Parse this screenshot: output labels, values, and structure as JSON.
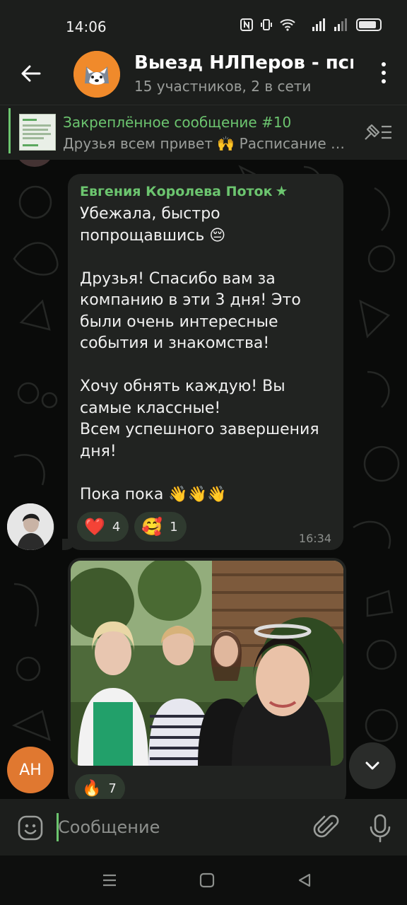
{
  "status_bar": {
    "time": "14:06"
  },
  "header": {
    "title": "Выезд НЛПеров - псих",
    "subtitle": "15 участников, 2 в сети"
  },
  "pinned": {
    "title": "Закреплённое сообщение #10",
    "text": "Друзья всем привет 🙌 Расписание н..."
  },
  "message": {
    "sender": "Евгения Королева Поток",
    "text": "Убежала, быстро\nпопрощавшись 😔\n\nДрузья! Спасибо вам за\nкомпанию в эти 3 дня! Это\nбыли очень интересные\nсобытия и знакомства!\n\nХочу обнять каждую! Вы\nсамые классные!\nВсем успешного завершения\nдня!\n\nПока пока 👋👋👋",
    "reactions": [
      {
        "emoji": "❤️",
        "count": "4"
      },
      {
        "emoji": "🥰",
        "count": "1"
      }
    ],
    "time": "16:34"
  },
  "photo_message": {
    "reaction": {
      "emoji": "🔥",
      "count": "7"
    }
  },
  "user_avatar_initials": "АН",
  "composer": {
    "placeholder": "Сообщение"
  },
  "colors": {
    "accent": "#6cc56f",
    "bubble": "#212321",
    "bar": "#1c1e1c",
    "avatar_orange": "#e07830"
  }
}
